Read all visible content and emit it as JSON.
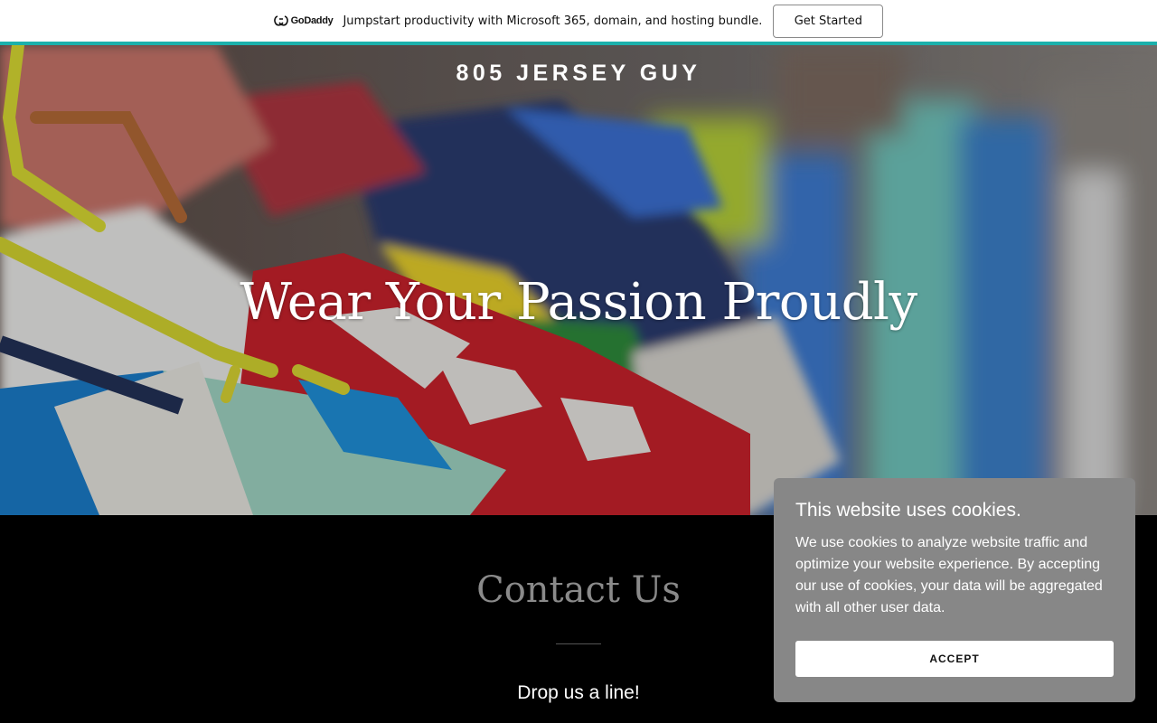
{
  "promo": {
    "logo_text": "GoDaddy",
    "message": "Jumpstart productivity with Microsoft 365, domain, and hosting bundle.",
    "cta_label": "Get Started",
    "accent_color": "#1bb1ac"
  },
  "hero": {
    "site_title": "805 JERSEY GUY",
    "headline": "Wear Your Passion Proudly"
  },
  "contact": {
    "title": "Contact Us",
    "subtitle": "Drop us a line!"
  },
  "cookie_banner": {
    "title": "This website uses cookies.",
    "body": "We use cookies to analyze website traffic and optimize your website experience. By accepting our use of cookies, your data will be aggregated with all other user data.",
    "accept_label": "ACCEPT"
  }
}
